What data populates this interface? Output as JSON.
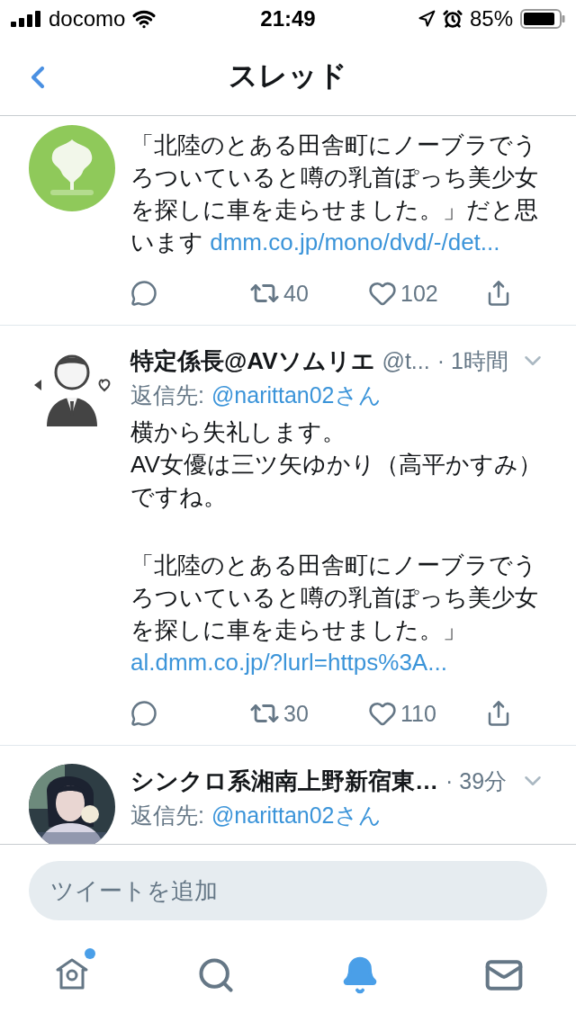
{
  "status_bar": {
    "carrier": "docomo",
    "time": "21:49",
    "battery": "85%"
  },
  "nav": {
    "title": "スレッド"
  },
  "tweets": [
    {
      "blocks": [
        [
          "「北陸のとある田舎町にノーブラでうろついていると噂の乳首ぽっち美少女を探しに車を走らせました。」だと思います"
        ]
      ],
      "link": "dmm.co.jp/mono/dvd/-/det...",
      "retweets": "40",
      "likes": "102"
    },
    {
      "name": "特定係長@AVソムリエ",
      "handle": "@t...",
      "time": "· 1時間",
      "reply_label": "返信先:",
      "reply_to": "@narittan02さん",
      "blocks": [
        [
          "横から失礼します。",
          "AV女優は三ツ矢ゆかり（高平かすみ）ですね。"
        ],
        [
          "「北陸のとある田舎町にノーブラでうろついていると噂の乳首ぽっち美少女を探しに車を走らせました。」"
        ]
      ],
      "link": "al.dmm.co.jp/?lurl=https%3A...",
      "retweets": "30",
      "likes": "110"
    },
    {
      "name": "シンクロ系湘南上野新宿東…",
      "time": "· 39分",
      "reply_label": "返信先:",
      "reply_to": "@narittan02さん"
    }
  ],
  "composer": {
    "placeholder": "ツイートを追加"
  },
  "tab_bar": [
    {
      "selected": false,
      "badge": true
    },
    {
      "selected": false,
      "badge": false
    },
    {
      "selected": true,
      "badge": false
    },
    {
      "selected": false,
      "badge": false
    }
  ]
}
